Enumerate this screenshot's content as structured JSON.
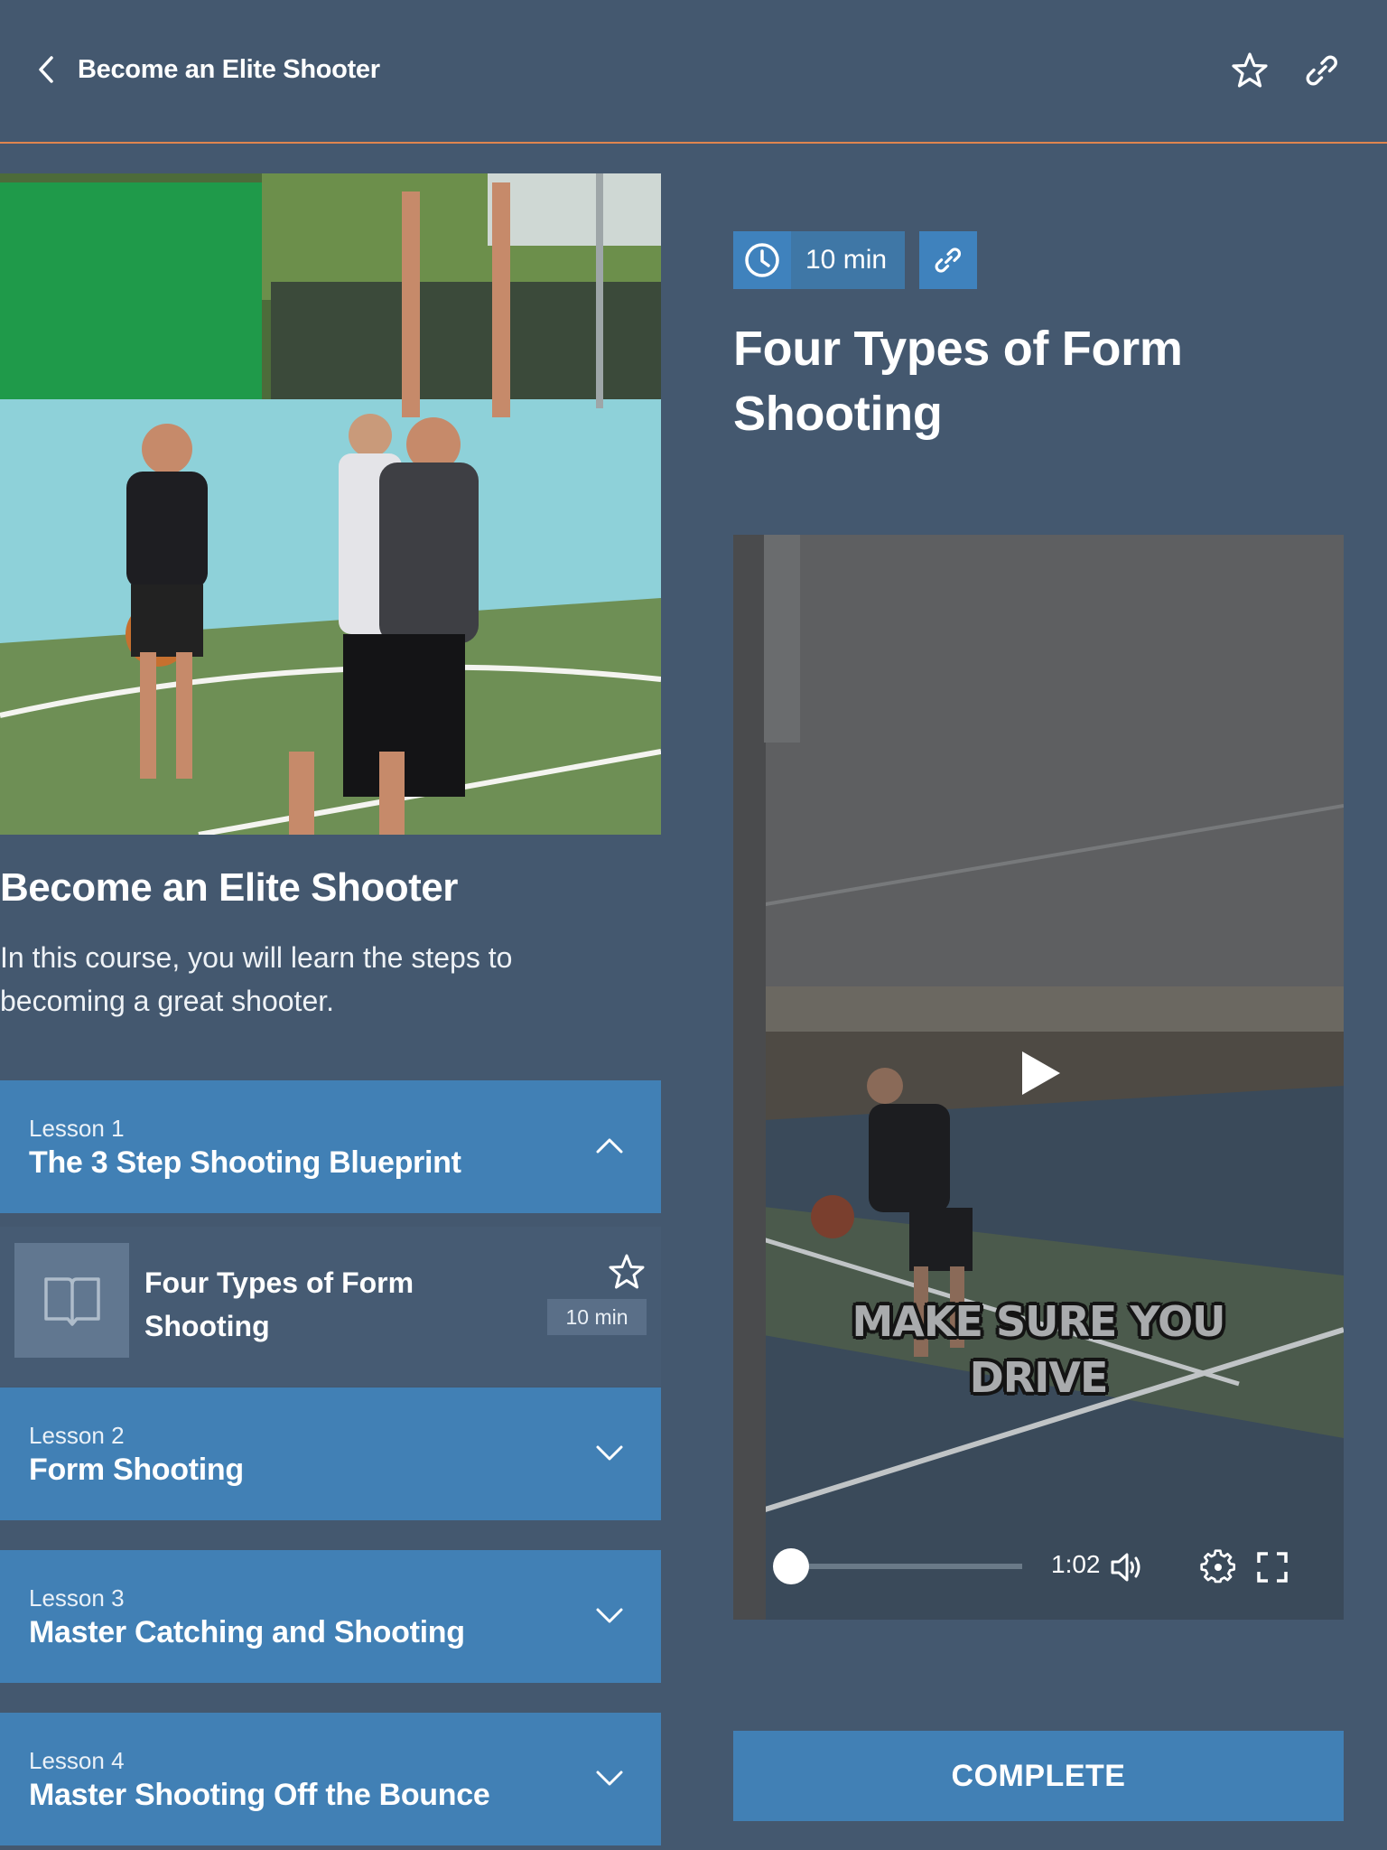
{
  "header": {
    "back_label": "Become an Elite Shooter",
    "icons": [
      "chevron-left-icon",
      "star-outline-icon",
      "link-icon"
    ]
  },
  "course": {
    "title": "Become an Elite Shooter",
    "description": "In this course, you will learn the steps to becoming a great shooter."
  },
  "lessons": [
    {
      "number_label": "Lesson 1",
      "title": "The 3 Step Shooting Blueprint",
      "expanded": true
    },
    {
      "number_label": "Lesson 2",
      "title": "Form Shooting",
      "expanded": false
    },
    {
      "number_label": "Lesson 3",
      "title": "Master Catching and Shooting",
      "expanded": false
    },
    {
      "number_label": "Lesson 4",
      "title": "Master Shooting Off the Bounce",
      "expanded": false
    }
  ],
  "lesson1_items": [
    {
      "title": "Four Types of Form Shooting",
      "duration": "10 min",
      "icon": "book-icon",
      "starred": false
    }
  ],
  "detail": {
    "duration": "10 min",
    "title": "Four Types of Form Shooting",
    "video": {
      "caption_line1": "MAKE SURE YOU",
      "caption_line2": "DRIVE",
      "time": "1:02",
      "progress_fraction": 0.0
    },
    "complete_label": "COMPLETE"
  },
  "colors": {
    "background": "#44586f",
    "accent_blue": "#4180b5",
    "header_rule": "#e0854f"
  }
}
